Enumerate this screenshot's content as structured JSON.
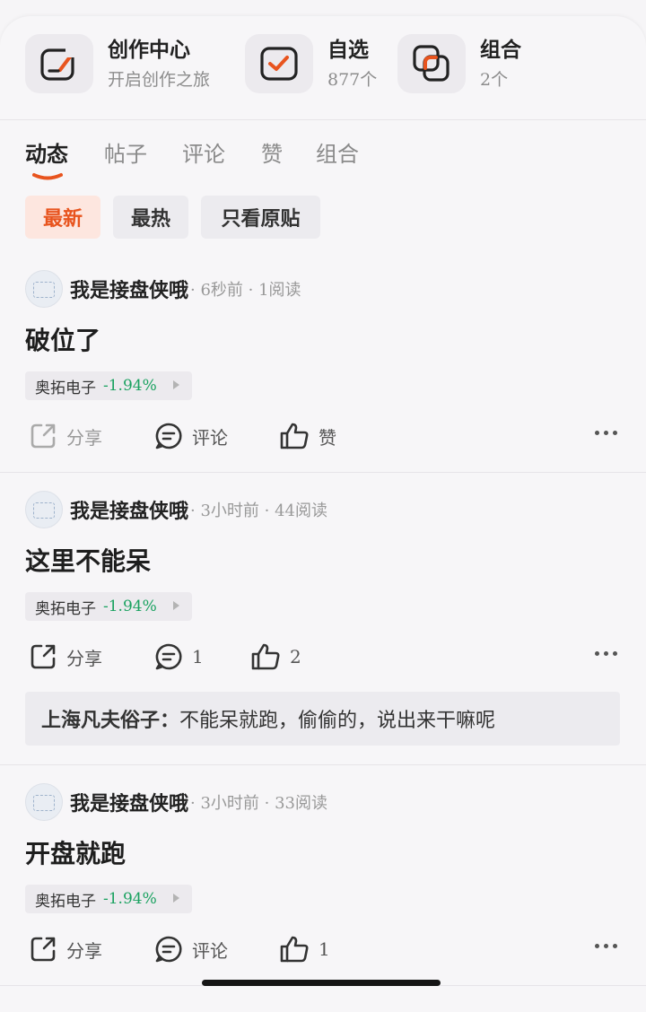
{
  "shortcuts": [
    {
      "title": "创作中心",
      "subtitle": "开启创作之旅",
      "icon": "create-icon"
    },
    {
      "title": "自选",
      "subtitle": "877个",
      "icon": "watchlist-check-icon"
    },
    {
      "title": "组合",
      "subtitle": "2个",
      "icon": "portfolio-icon"
    }
  ],
  "tabs": [
    "动态",
    "帖子",
    "评论",
    "赞",
    "组合"
  ],
  "active_tab": "动态",
  "filters": [
    "最新",
    "最热",
    "只看原贴"
  ],
  "active_filter": "最新",
  "colors": {
    "accent": "#e8541e",
    "stock_down": "#1aa260"
  },
  "posts": [
    {
      "author": "我是接盘侠哦",
      "meta": "· 6秒前 · 1阅读",
      "text": "破位了",
      "stock": {
        "name": "奥拓电子",
        "change": "-1.94%"
      },
      "actions": {
        "share": "分享",
        "comment": "评论",
        "like": "赞"
      }
    },
    {
      "author": "我是接盘侠哦",
      "meta": "· 3小时前 · 44阅读",
      "text": "这里不能呆",
      "stock": {
        "name": "奥拓电子",
        "change": "-1.94%"
      },
      "actions": {
        "share": "分享",
        "comment": "1",
        "like": "2"
      },
      "reply": {
        "author": "上海凡夫俗子：",
        "text": "不能呆就跑，偷偷的，说出来干嘛呢"
      }
    },
    {
      "author": "我是接盘侠哦",
      "meta": "· 3小时前 · 33阅读",
      "text": "开盘就跑",
      "stock": {
        "name": "奥拓电子",
        "change": "-1.94%"
      },
      "actions": {
        "share": "分享",
        "comment": "评论",
        "like": "1"
      }
    }
  ]
}
